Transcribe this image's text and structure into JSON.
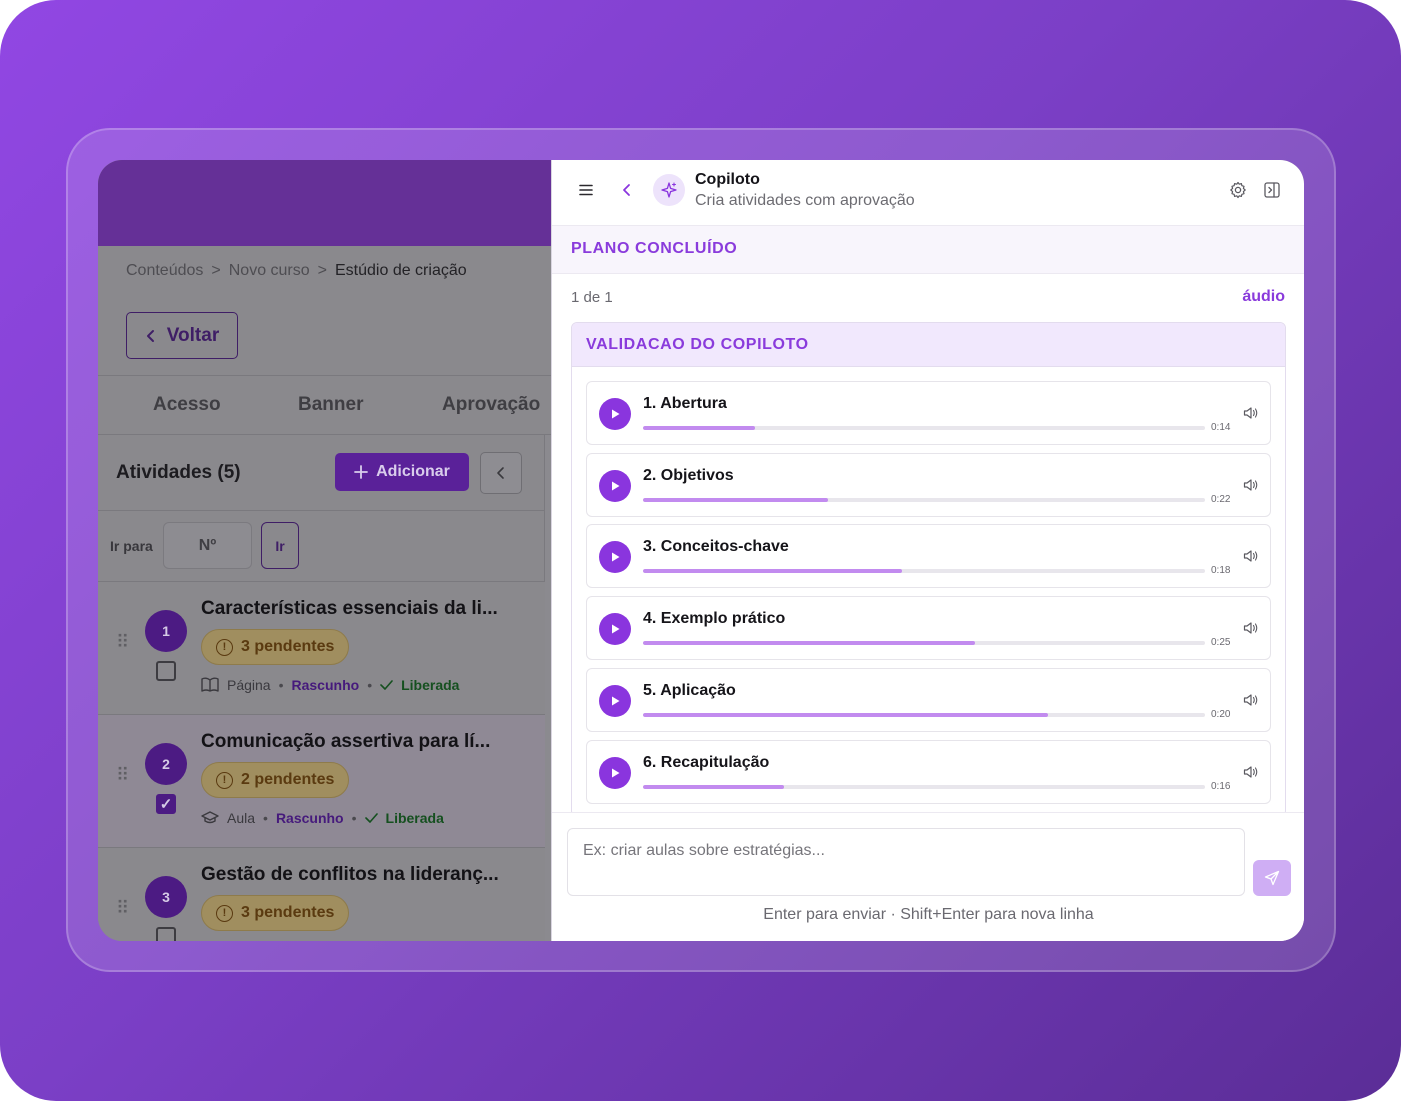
{
  "breadcrumb": {
    "items": [
      "Conteúdos",
      "Novo curso",
      "Estúdio de criação"
    ],
    "sep": ">"
  },
  "back_label": "Voltar",
  "tabs": [
    "Acesso",
    "Banner",
    "Aprovação"
  ],
  "activities": {
    "title": "Atividades (5)",
    "add_label": "Adicionar",
    "goto_label": "Ir para",
    "goto_placeholder": "Nº",
    "goto_button": "Ir",
    "items": [
      {
        "number": "1",
        "title": "Características essenciais da li...",
        "pending": "3 pendentes",
        "type": "Página",
        "status": "Rascunho",
        "release": "Liberada",
        "checked": false,
        "type_icon": "book-icon"
      },
      {
        "number": "2",
        "title": "Comunicação assertiva para lí...",
        "pending": "2 pendentes",
        "type": "Aula",
        "status": "Rascunho",
        "release": "Liberada",
        "checked": true,
        "type_icon": "graduation-cap-icon"
      },
      {
        "number": "3",
        "title": "Gestão de conflitos na lideranç...",
        "pending": "3 pendentes",
        "type": "",
        "status": "",
        "release": "",
        "checked": false,
        "type_icon": ""
      }
    ]
  },
  "copilot": {
    "title": "Copiloto",
    "subtitle": "Cria atividades com aprovação",
    "plan_status": "PLANO CONCLUÍDO",
    "pager": "1 de 1",
    "audio_link": "áudio",
    "validation_title": "VALIDACAO DO COPILOTO",
    "tracks": [
      {
        "name": "1. Abertura",
        "time": "0:14",
        "progress": 0.2
      },
      {
        "name": "2. Objetivos",
        "time": "0:22",
        "progress": 0.33
      },
      {
        "name": "3. Conceitos-chave",
        "time": "0:18",
        "progress": 0.46
      },
      {
        "name": "4. Exemplo prático",
        "time": "0:25",
        "progress": 0.59
      },
      {
        "name": "5. Aplicação",
        "time": "0:20",
        "progress": 0.72
      },
      {
        "name": "6. Recapitulação",
        "time": "0:16",
        "progress": 0.25
      }
    ],
    "input_placeholder": "Ex: criar aulas sobre estratégias...",
    "hint": "Enter para enviar · Shift+Enter para nova linha"
  },
  "colors": {
    "accent": "#8a35de",
    "accent_dark": "#5a2199",
    "background_gradient_start": "#9147e3",
    "background_gradient_end": "#5b2d97"
  }
}
